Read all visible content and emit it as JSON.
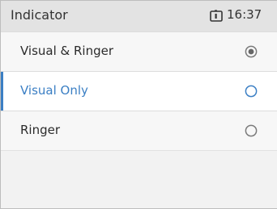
{
  "status_bar": {
    "title": "Indicator",
    "time": "16:37",
    "status_icon": "sim-card-icon"
  },
  "options": [
    {
      "label": "Visual & Ringer",
      "checked": true,
      "focused": false
    },
    {
      "label": "Visual Only",
      "checked": false,
      "focused": true
    },
    {
      "label": "Ringer",
      "checked": false,
      "focused": false
    }
  ],
  "colors": {
    "accent": "#3b7fc4",
    "text": "#2b2b2b",
    "status_bar_bg": "#e3e3e3",
    "radio_border": "#7a7a7a"
  }
}
